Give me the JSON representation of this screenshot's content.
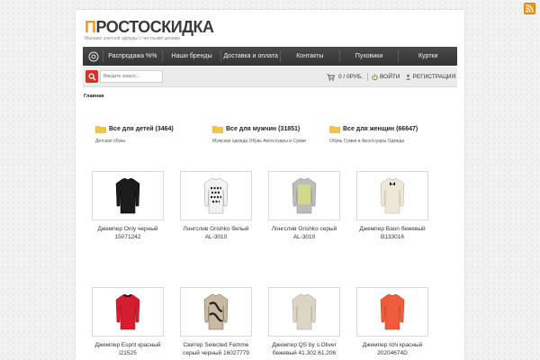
{
  "header": {
    "logo_first": "П",
    "logo_rest": "РОСТОСКИДКА",
    "tagline": "Магазин элитной одежды с честными ценами"
  },
  "nav": {
    "items": [
      {
        "label": "Распродажа %%"
      },
      {
        "label": "Наши бренды"
      },
      {
        "label": "Доставка и оплата"
      },
      {
        "label": "Контакты"
      },
      {
        "label": "Пуховики"
      },
      {
        "label": "Куртки"
      }
    ]
  },
  "toolbar": {
    "search_placeholder": "Введите запрос...",
    "cart_text": "0 / 0РУБ.",
    "login_label": "ВОЙТИ",
    "register_label": "РЕГИСТРАЦИЯ"
  },
  "breadcrumb": "Главная",
  "categories": [
    {
      "title": "Все для детей (3464)",
      "sub": "Детская обувь"
    },
    {
      "title": "Все для мужчин (31851)",
      "sub": "Мужская одежда Обувь Аксессуары и Сумки"
    },
    {
      "title": "Все для женщин (66647)",
      "sub": "Обувь Сумки и Аксессуары Одежда"
    }
  ],
  "products": [
    {
      "name": "Джемпер Only черный 15071242",
      "color": "#1c1c1c"
    },
    {
      "name": "Лонгслив Grishko белый AL-3010",
      "color": "#f2f2f2"
    },
    {
      "name": "Лонгслив Grishko серый AL-3010",
      "color": "#d4d889"
    },
    {
      "name": "Джемпер Baon бежевый B133016",
      "color": "#eee6d6"
    },
    {
      "name": "Джемпер Esprit красный i21525",
      "color": "#d41e2f"
    },
    {
      "name": "Свитер Selected Femme серый черный 16027779",
      "color": "#c9b9a1"
    },
    {
      "name": "Джемпер QS by s.Oliver бежевый 41.302.61.206",
      "color": "#dcd5c4"
    },
    {
      "name": "Джемпер Ichi красный 20204674D",
      "color": "#ef5b3d"
    }
  ],
  "colors": {
    "accent": "#f39a1d",
    "nav_bg": "#3d3d3d",
    "search_btn": "#d6312a"
  },
  "icons": {
    "rss": "rss-icon",
    "home": "home-icon",
    "search": "search-icon",
    "cart": "cart-icon",
    "login": "power-icon",
    "register": "user-icon",
    "folder": "folder-icon"
  }
}
